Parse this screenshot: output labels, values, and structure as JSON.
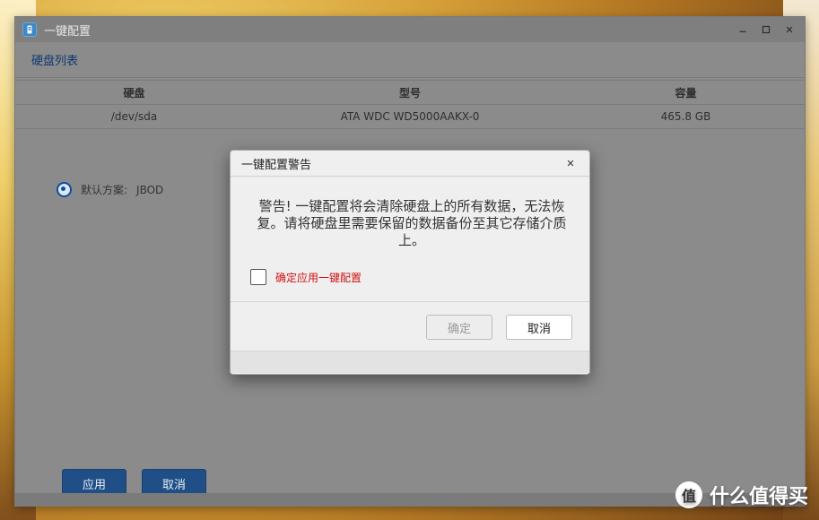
{
  "window": {
    "title": "一键配置",
    "section_title": "硬盘列表",
    "table": {
      "headers": [
        "硬盘",
        "型号",
        "容量"
      ],
      "rows": [
        [
          "/dev/sda",
          "ATA WDC WD5000AAKX-0",
          "465.8 GB"
        ]
      ]
    },
    "default_scheme_label": "默认方案:",
    "default_scheme_value": "JBOD",
    "apply_label": "应用",
    "cancel_label": "取消"
  },
  "dialog": {
    "title": "一键配置警告",
    "message": "警告! 一键配置将会清除硬盘上的所有数据，无法恢复。请将硬盘里需要保留的数据备份至其它存储介质上。",
    "checkbox_label": "确定应用一键配置",
    "ok_label": "确定",
    "cancel_label": "取消"
  },
  "watermark": {
    "badge": "值",
    "text": "什么值得买"
  }
}
